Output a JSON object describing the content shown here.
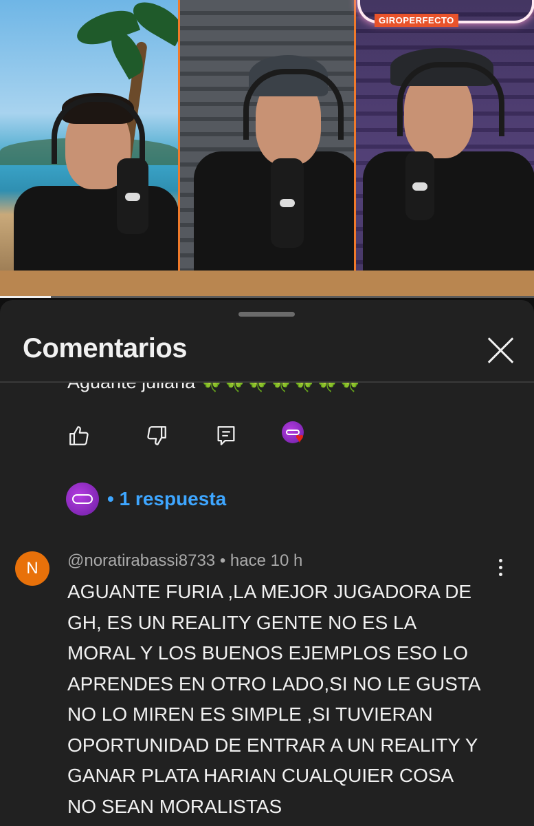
{
  "video": {
    "overlay_logo": "GIROPERFECTO",
    "progress": 0.095
  },
  "comments_panel": {
    "title": "Comentarios",
    "close_icon": "close-icon",
    "previous_comment": {
      "visible_text": "Aguante juliana 🍀🍀🍀🍀🍀🍀🍀",
      "actions": [
        "like-icon",
        "dislike-icon",
        "reply-icon",
        "creator-heart-icon"
      ],
      "replies_label": "• 1 respuesta"
    },
    "comment": {
      "avatar_letter": "N",
      "author": "@noratirabassi8733",
      "time": " • hace 10 h",
      "lines": [
        "AGUANTE FURIA ,LA MEJOR JUGADORA DE",
        "GH, ES UN REALITY GENTE NO ES LA",
        "MORAL Y LOS BUENOS EJEMPLOS  ESO  LO",
        "APRENDES EN OTRO LADO,SI NO LE GUSTA",
        "NO LO MIREN ES SIMPLE ,SI TUVIERAN",
        "OPORTUNIDAD DE ENTRAR A UN REALITY Y",
        "GANAR PLATA HARIAN CUALQUIER COSA",
        "NO SEAN MORALISTAS"
      ]
    },
    "colors": {
      "sheet_bg": "#212121",
      "link_blue": "#3ea6ff",
      "avatar_orange": "#e8710a",
      "accent_orange": "#f07a2a"
    }
  }
}
